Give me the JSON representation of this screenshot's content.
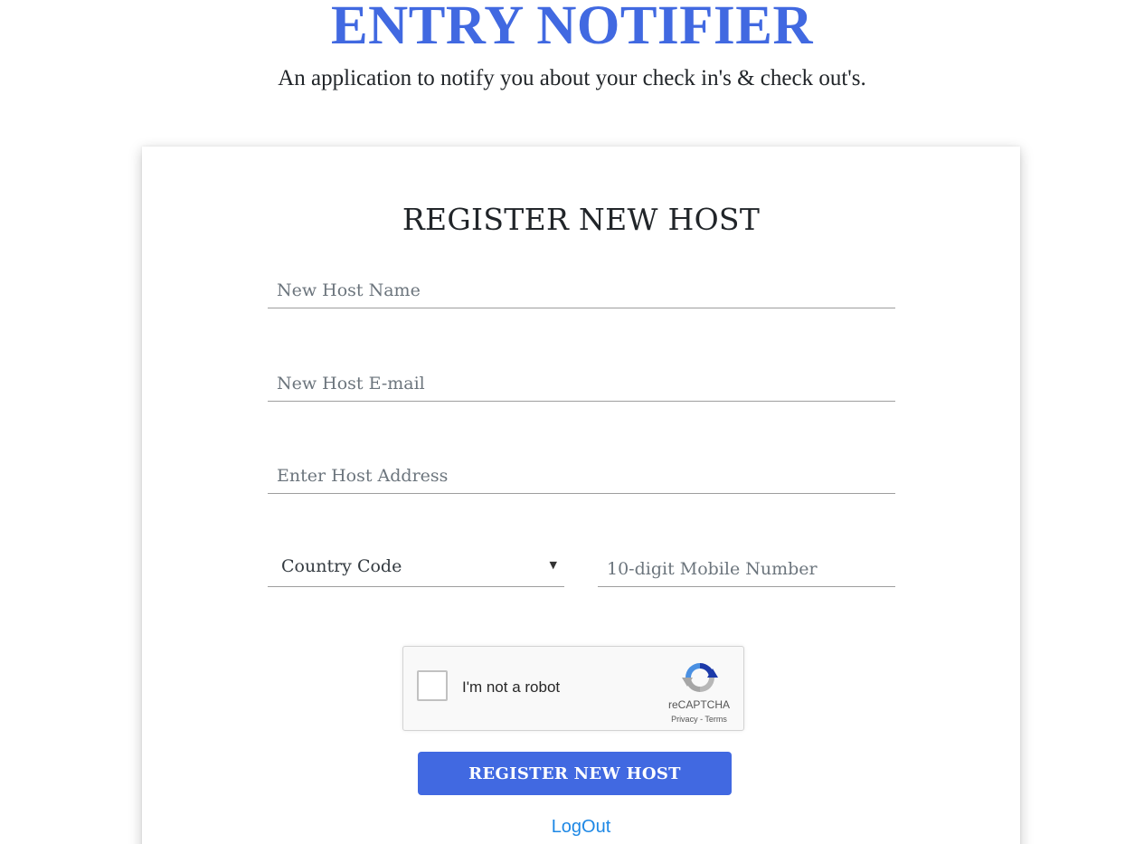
{
  "header": {
    "title": "ENTRY NOTIFIER",
    "subtitle": "An application to notify you about your check in's & check out's."
  },
  "form": {
    "title": "REGISTER NEW HOST",
    "name_placeholder": "New Host Name",
    "email_placeholder": "New Host E-mail",
    "address_placeholder": "Enter Host Address",
    "country_code_label": "Country Code",
    "mobile_placeholder": "10-digit Mobile Number",
    "submit_label": "REGISTER NEW HOST",
    "logout_label": "LogOut"
  },
  "captcha": {
    "label": "I'm not a robot",
    "brand": "reCAPTCHA",
    "privacy": "Privacy",
    "separator": " - ",
    "terms": "Terms",
    "icon": "recaptcha-logo-icon"
  },
  "colors": {
    "accent": "#4169e1",
    "link": "#1e88e5",
    "text": "#212529"
  }
}
